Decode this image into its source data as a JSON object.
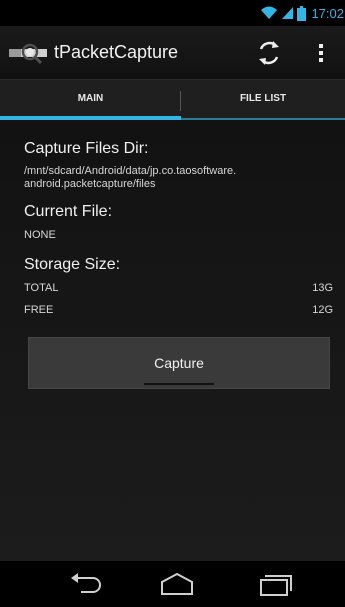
{
  "status_bar": {
    "time": "17:02",
    "icons": [
      "wifi-icon",
      "signal-icon",
      "battery-icon"
    ]
  },
  "action_bar": {
    "app_title": "tPacketCapture",
    "icons": [
      "app-logo-icon",
      "refresh-icon",
      "overflow-menu-icon"
    ]
  },
  "tabs": [
    {
      "label": "MAIN",
      "selected": true
    },
    {
      "label": "FILE LIST",
      "selected": false
    }
  ],
  "main": {
    "capture_dir_heading": "Capture Files Dir:",
    "capture_dir_line1": "/mnt/sdcard/Android/data/jp.co.taosoftware.",
    "capture_dir_line2": "android.packetcapture/files",
    "current_file_heading": "Current File:",
    "current_file_value": "NONE",
    "storage_heading": "Storage Size:",
    "storage": {
      "total_label": "TOTAL",
      "total_value": "13G",
      "free_label": "FREE",
      "free_value": "12G"
    },
    "capture_button_label": "Capture"
  },
  "nav_bar": {
    "icons": [
      "back-icon",
      "home-icon",
      "recents-icon"
    ]
  },
  "colors": {
    "accent": "#33b5e5",
    "background": "#000000",
    "button": "#3a3a3a"
  }
}
